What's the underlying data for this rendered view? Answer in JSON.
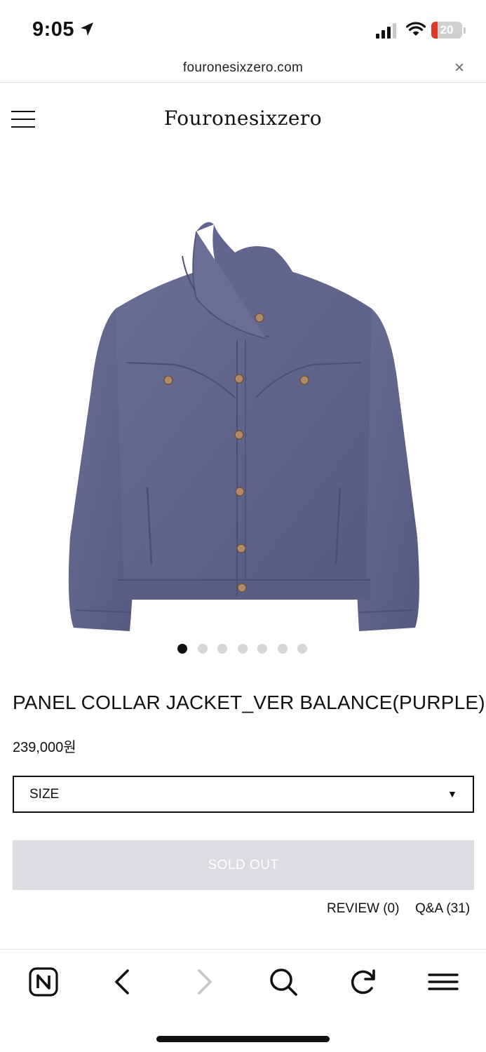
{
  "status_bar": {
    "time": "9:05",
    "battery_level": "20",
    "battery_fraction": 0.2,
    "battery_color": "#e0352b"
  },
  "browser": {
    "url": "fouronesixzero.com",
    "close_glyph": "×"
  },
  "site": {
    "logo": "Fouronesixzero"
  },
  "product": {
    "image_icon": "purple-denim-jacket-image",
    "carousel": {
      "total": 7,
      "active_index": 0
    },
    "title": "PANEL COLLAR JACKET_VER BALANCE(PURPLE)",
    "price": "239,000원",
    "size_select": {
      "label": "SIZE",
      "arrow": "▼"
    },
    "soldout_label": "SOLD OUT",
    "review_link": "REVIEW (0)",
    "qa_link": "Q&A (31)"
  },
  "toolbar": {
    "items": [
      "naver-home-icon",
      "back-icon",
      "forward-icon",
      "search-icon",
      "reload-icon",
      "menu-icon"
    ]
  },
  "colors": {
    "text": "#111111",
    "soldout_bg": "#dcdde0",
    "dot_inactive": "#d6d6d6",
    "jacket": "#5e6288"
  }
}
